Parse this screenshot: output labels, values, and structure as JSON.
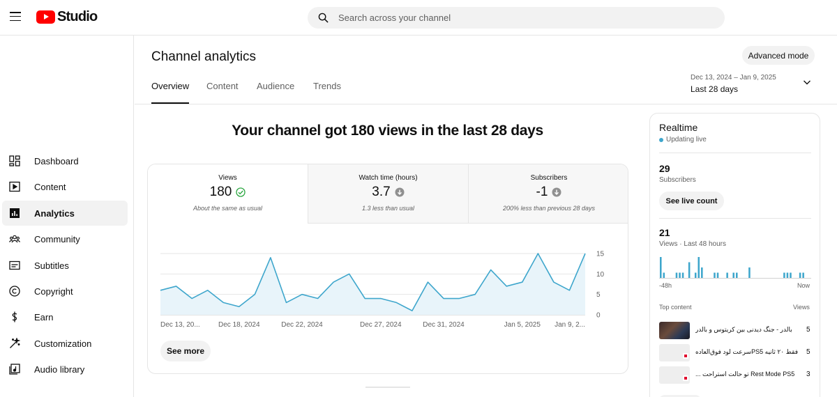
{
  "header": {
    "logo_text": "Studio",
    "search_placeholder": "Search across your channel"
  },
  "sidebar": {
    "items": [
      {
        "label": "Dashboard",
        "icon": "dashboard-icon"
      },
      {
        "label": "Content",
        "icon": "content-icon"
      },
      {
        "label": "Analytics",
        "icon": "analytics-icon",
        "active": true
      },
      {
        "label": "Community",
        "icon": "community-icon"
      },
      {
        "label": "Subtitles",
        "icon": "subtitles-icon"
      },
      {
        "label": "Copyright",
        "icon": "copyright-icon"
      },
      {
        "label": "Earn",
        "icon": "earn-icon"
      },
      {
        "label": "Customization",
        "icon": "customization-icon"
      },
      {
        "label": "Audio library",
        "icon": "audio-library-icon"
      }
    ]
  },
  "main": {
    "title": "Channel analytics",
    "advanced_mode": "Advanced mode",
    "tabs": [
      "Overview",
      "Content",
      "Audience",
      "Trends"
    ],
    "active_tab": "Overview",
    "date_range": {
      "sub": "Dec 13, 2024 – Jan 9, 2025",
      "main": "Last 28 days"
    },
    "headline": "Your channel got 180 views in the last 28 days",
    "metrics": [
      {
        "label": "Views",
        "value": "180",
        "status": "check-circle-icon",
        "note": "About the same as usual"
      },
      {
        "label": "Watch time (hours)",
        "value": "3.7",
        "status": "down-arrow-icon",
        "note": "1.3 less than usual"
      },
      {
        "label": "Subscribers",
        "value": "-1",
        "status": "down-arrow-icon",
        "note": "200% less than previous 28 days"
      }
    ],
    "see_more": "See more"
  },
  "chart_data": {
    "type": "area",
    "x": [
      "Dec 13",
      "Dec 14",
      "Dec 15",
      "Dec 16",
      "Dec 17",
      "Dec 18",
      "Dec 19",
      "Dec 20",
      "Dec 21",
      "Dec 22",
      "Dec 23",
      "Dec 24",
      "Dec 25",
      "Dec 26",
      "Dec 27",
      "Dec 28",
      "Dec 29",
      "Dec 30",
      "Dec 31",
      "Jan 1",
      "Jan 2",
      "Jan 3",
      "Jan 4",
      "Jan 5",
      "Jan 6",
      "Jan 7",
      "Jan 8",
      "Jan 9"
    ],
    "values": [
      6,
      7,
      4,
      6,
      3,
      2,
      5,
      14,
      3,
      5,
      4,
      8,
      10,
      4,
      4,
      3,
      1,
      8,
      4,
      4,
      5,
      11,
      7,
      8,
      15,
      8,
      6,
      15
    ],
    "xtick_labels": [
      "Dec 13, 20...",
      "Dec 18, 2024",
      "Dec 22, 2024",
      "Dec 27, 2024",
      "Dec 31, 2024",
      "Jan 5, 2025",
      "Jan 9, 2..."
    ],
    "yticks": [
      "0",
      "5",
      "10",
      "15"
    ],
    "ylim": [
      0,
      15
    ],
    "grid": true,
    "color": "#3ea6cc",
    "fill": "#e8f4fa"
  },
  "realtime": {
    "title": "Realtime",
    "status": "Updating live",
    "subscribers": {
      "value": "29",
      "label": "Subscribers"
    },
    "live_count_button": "See live count",
    "views": {
      "value": "21",
      "label": "Views · Last 48 hours"
    },
    "bar_values": [
      4,
      1,
      0,
      0,
      0,
      1,
      1,
      1,
      0,
      3,
      0,
      1,
      4,
      2,
      0,
      0,
      0,
      1,
      1,
      0,
      0,
      1,
      0,
      1,
      1,
      0,
      0,
      0,
      2,
      0,
      0,
      0,
      0,
      0,
      0,
      0,
      0,
      0,
      0,
      1,
      1,
      1,
      0,
      0,
      1,
      1,
      0,
      0
    ],
    "axis_left": "-48h",
    "axis_right": "Now",
    "top_content_label": "Top content",
    "top_content_views_label": "Views",
    "top_content": [
      {
        "title": "بالدر - جنگ دیدنی بین کریتوس و بالدر",
        "views": "5"
      },
      {
        "title": "فقط ۲۰ ثانیه PS5سرعت لود فوق‌العاده",
        "views": "5"
      },
      {
        "title": "Rest Mode PS5 تو حالت استراحت ...",
        "views": "3"
      }
    ]
  },
  "colors": {
    "accent": "#3ea6cc",
    "brand": "#ff0000",
    "text": "#0f0f0f",
    "muted": "#606060"
  }
}
